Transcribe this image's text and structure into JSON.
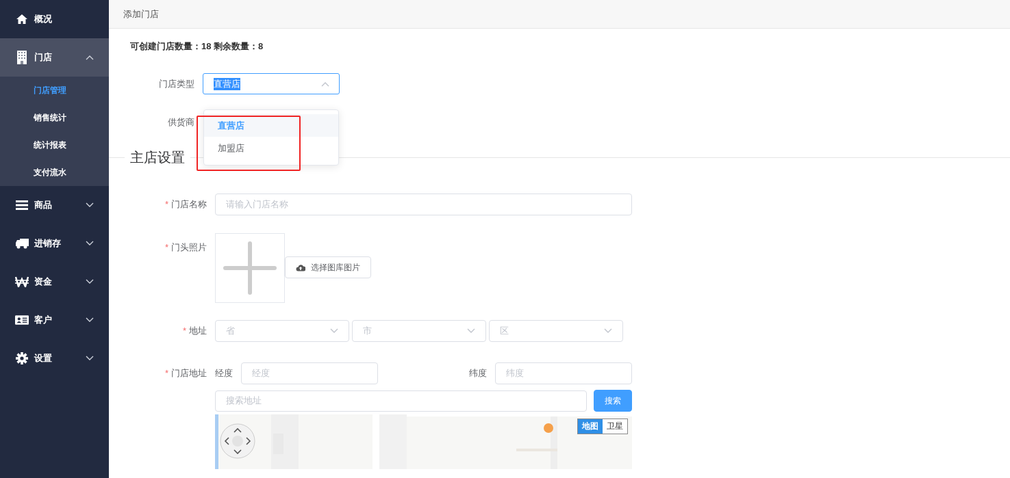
{
  "sidebar": {
    "items": [
      {
        "label": "概况",
        "expanded": false,
        "has_arrow": false
      },
      {
        "label": "门店",
        "expanded": true,
        "has_arrow": true,
        "children": [
          {
            "label": "门店管理",
            "selected": true
          },
          {
            "label": "销售统计",
            "selected": false
          },
          {
            "label": "统计报表",
            "selected": false
          },
          {
            "label": "支付流水",
            "selected": false
          }
        ]
      },
      {
        "label": "商品",
        "expanded": false,
        "has_arrow": true
      },
      {
        "label": "进销存",
        "expanded": false,
        "has_arrow": true
      },
      {
        "label": "资金",
        "expanded": false,
        "has_arrow": true
      },
      {
        "label": "客户",
        "expanded": false,
        "has_arrow": true
      },
      {
        "label": "设置",
        "expanded": false,
        "has_arrow": true
      }
    ]
  },
  "header": {
    "title": "添加门店"
  },
  "summary": "可创建门店数量：18 剩余数量：8",
  "store_type": {
    "label": "门店类型",
    "value": "直营店",
    "value_selected": true,
    "expanded": true,
    "options": [
      {
        "label": "直营店",
        "selected": true
      },
      {
        "label": "加盟店",
        "selected": false
      }
    ]
  },
  "supplier": {
    "label": "供货商"
  },
  "section_title": "主店设置",
  "store_name": {
    "required_mark": "*",
    "label": "门店名称",
    "placeholder": "请输入门店名称"
  },
  "photo": {
    "required_mark": "*",
    "label": "门头照片",
    "button": "选择图库图片"
  },
  "address": {
    "required_mark": "*",
    "label": "地址",
    "selects": [
      {
        "placeholder": "省"
      },
      {
        "placeholder": "市"
      },
      {
        "placeholder": "区"
      }
    ]
  },
  "location": {
    "required_mark": "*",
    "label": "门店地址",
    "longitude_label": "经度",
    "longitude_placeholder": "经度",
    "latitude_label": "纬度",
    "latitude_placeholder": "纬度",
    "search_placeholder": "搜索地址",
    "search_button": "搜索",
    "map": {
      "kind": "picture",
      "map_types": [
        {
          "label": "地图",
          "selected": true
        },
        {
          "label": "卫星",
          "selected": false
        }
      ]
    }
  }
}
